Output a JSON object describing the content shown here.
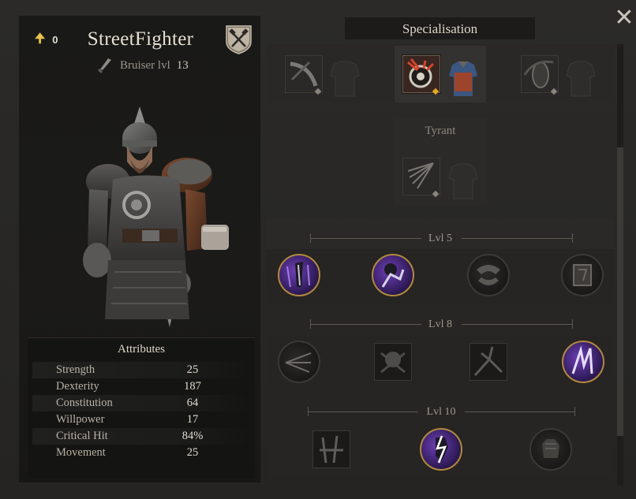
{
  "character": {
    "name": "StreetFighter",
    "unspent_points": "0",
    "class_name": "Bruiser lvl",
    "level": "13"
  },
  "attributes": {
    "title": "Attributes",
    "rows": [
      {
        "name": "Strength",
        "value": "25"
      },
      {
        "name": "Dexterity",
        "value": "187"
      },
      {
        "name": "Constitution",
        "value": "64"
      },
      {
        "name": "Willpower",
        "value": "17"
      },
      {
        "name": "Critical Hit",
        "value": "84%"
      },
      {
        "name": "Movement",
        "value": "25"
      }
    ]
  },
  "specialisation": {
    "title": "Specialisation",
    "options": [
      {
        "icon": "scythe-slash-icon",
        "armor": "armor-silhouette-icon",
        "selected": false
      },
      {
        "icon": "red-impact-icon",
        "armor": "armor-red-icon",
        "selected": true
      },
      {
        "icon": "shield-spin-icon",
        "armor": "armor-silhouette-icon",
        "selected": false
      }
    ],
    "sub_spec": {
      "label": "Tyrant",
      "icon": "claw-sweep-icon",
      "armor": "armor-silhouette-icon"
    }
  },
  "skill_tiers": [
    {
      "label": "Lvl 5",
      "skills": [
        {
          "icon": "dagger-strike-icon",
          "active": true
        },
        {
          "icon": "shadow-fist-icon",
          "active": true
        },
        {
          "icon": "beast-jaw-icon",
          "active": false
        },
        {
          "icon": "tome-icon",
          "active": false
        }
      ]
    },
    {
      "label": "Lvl 8",
      "skills": [
        {
          "icon": "arrow-split-icon",
          "active": false,
          "shape": "circle"
        },
        {
          "icon": "skull-bones-icon",
          "active": false,
          "shape": "square"
        },
        {
          "icon": "shatter-icon",
          "active": false,
          "shape": "square"
        },
        {
          "icon": "claw-marks-icon",
          "active": true,
          "shape": "circle"
        }
      ]
    },
    {
      "label": "Lvl 10",
      "skills": [
        {
          "icon": "twin-blades-icon",
          "active": false,
          "shape": "square"
        },
        {
          "icon": "lightning-hand-icon",
          "active": true,
          "shape": "circle"
        },
        {
          "icon": "gauntlet-icon",
          "active": false,
          "shape": "circle"
        }
      ]
    }
  ],
  "colors": {
    "accent_gold": "#e6c24a",
    "active_purple": "#6d3fb5",
    "selected_gem": "#e2a526"
  }
}
